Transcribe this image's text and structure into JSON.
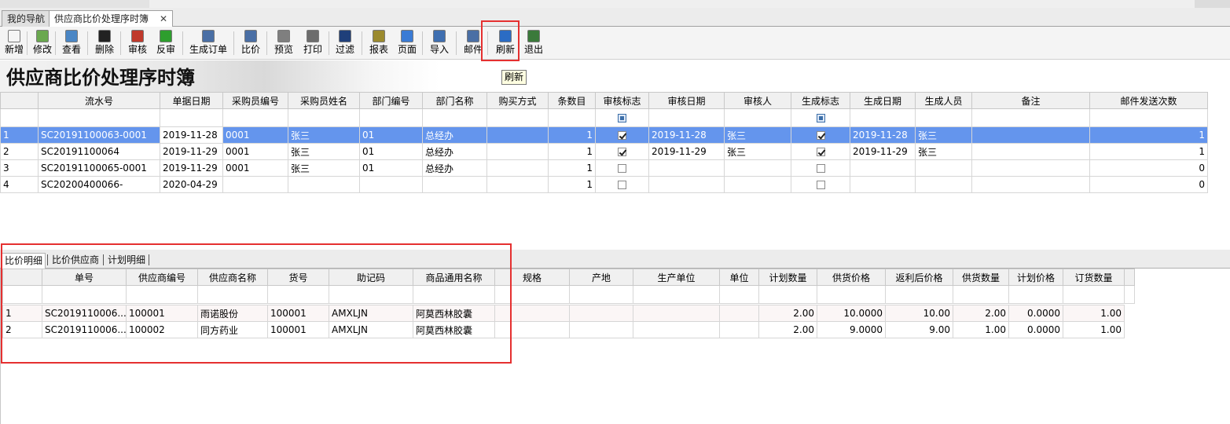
{
  "tabs": [
    {
      "label": "我的导航"
    },
    {
      "label": "供应商比价处理序时簿"
    }
  ],
  "toolbar": [
    {
      "label": "新增",
      "icon": "new-doc-icon",
      "color": "#f5f5f5"
    },
    {
      "label": "修改",
      "icon": "edit-icon",
      "color": "#6aa84f"
    },
    {
      "label": "查看",
      "icon": "view-icon",
      "color": "#4a86c5"
    },
    {
      "label": "删除",
      "icon": "delete-icon",
      "color": "#222222"
    },
    {
      "label": "审核",
      "icon": "audit-icon",
      "color": "#c0392b"
    },
    {
      "label": "反审",
      "icon": "unaudit-icon",
      "color": "#2e9e2e"
    },
    {
      "label": "生成订单",
      "icon": "order-icon",
      "color": "#4a6fa5"
    },
    {
      "label": "比价",
      "icon": "compare-icon",
      "color": "#4a6fa5"
    },
    {
      "label": "预览",
      "icon": "preview-icon",
      "color": "#7f7f7f"
    },
    {
      "label": "打印",
      "icon": "print-icon",
      "color": "#6d6d6d"
    },
    {
      "label": "过滤",
      "icon": "filter-icon",
      "color": "#1f3f7a"
    },
    {
      "label": "报表",
      "icon": "report-icon",
      "color": "#9b8a2e"
    },
    {
      "label": "页面",
      "icon": "page-icon",
      "color": "#3a7bd5"
    },
    {
      "label": "导入",
      "icon": "import-icon",
      "color": "#3f6fb0"
    },
    {
      "label": "邮件",
      "icon": "mail-icon",
      "color": "#4a6fa5"
    },
    {
      "label": "刷新",
      "icon": "refresh-icon",
      "color": "#2b6cc4"
    },
    {
      "label": "退出",
      "icon": "exit-icon",
      "color": "#3b7a3b"
    }
  ],
  "page_title": "供应商比价处理序时簿",
  "tooltip": "刷新",
  "main_grid": {
    "columns": [
      "流水号",
      "单据日期",
      "采购员编号",
      "采购员姓名",
      "部门编号",
      "部门名称",
      "购买方式",
      "条数目",
      "审核标志",
      "审核日期",
      "审核人",
      "生成标志",
      "生成日期",
      "生成人员",
      "备注",
      "邮件发送次数"
    ],
    "rows": [
      {
        "idx": "1",
        "serial": "SC20191100063-0001",
        "date": "2019-11-28",
        "buyer_no": "0001",
        "buyer": "张三",
        "dept_no": "01",
        "dept": "总经办",
        "method": "",
        "count": "1",
        "audited": true,
        "audit_date": "2019-11-28",
        "auditor": "张三",
        "generated": true,
        "gen_date": "2019-11-28",
        "gen_by": "张三",
        "remark": "",
        "mails": "1"
      },
      {
        "idx": "2",
        "serial": "SC20191100064",
        "date": "2019-11-29",
        "buyer_no": "0001",
        "buyer": "张三",
        "dept_no": "01",
        "dept": "总经办",
        "method": "",
        "count": "1",
        "audited": true,
        "audit_date": "2019-11-29",
        "auditor": "张三",
        "generated": true,
        "gen_date": "2019-11-29",
        "gen_by": "张三",
        "remark": "",
        "mails": "1"
      },
      {
        "idx": "3",
        "serial": "SC20191100065-0001",
        "date": "2019-11-29",
        "buyer_no": "0001",
        "buyer": "张三",
        "dept_no": "01",
        "dept": "总经办",
        "method": "",
        "count": "1",
        "audited": false,
        "audit_date": "",
        "auditor": "",
        "generated": false,
        "gen_date": "",
        "gen_by": "",
        "remark": "",
        "mails": "0"
      },
      {
        "idx": "4",
        "serial": "SC20200400066-",
        "date": "2020-04-29",
        "buyer_no": "",
        "buyer": "",
        "dept_no": "",
        "dept": "",
        "method": "",
        "count": "1",
        "audited": false,
        "audit_date": "",
        "auditor": "",
        "generated": false,
        "gen_date": "",
        "gen_by": "",
        "remark": "",
        "mails": "0"
      }
    ]
  },
  "detail_tabs": [
    {
      "label": "比价明细"
    },
    {
      "label": "比价供应商"
    },
    {
      "label": "计划明细"
    }
  ],
  "detail_grid": {
    "columns": [
      "单号",
      "供应商编号",
      "供应商名称",
      "货号",
      "助记码",
      "商品通用名称",
      "规格",
      "产地",
      "生产单位",
      "单位",
      "计划数量",
      "供货价格",
      "返利后价格",
      "供货数量",
      "计划价格",
      "订货数量"
    ],
    "rows": [
      {
        "idx": "1",
        "order": "SC2019110006...",
        "sup_no": "100001",
        "sup_name": "雨诺股份",
        "sku": "100001",
        "code": "AMXLJN",
        "name": "阿莫西林胶囊",
        "spec": "",
        "origin": "",
        "maker": "",
        "unit": "",
        "plan_qty": "2.00",
        "price": "10.0000",
        "rebate": "10.00",
        "supply_qty": "2.00",
        "plan_price": "0.0000",
        "order_qty": "1.00"
      },
      {
        "idx": "2",
        "order": "SC2019110006...",
        "sup_no": "100002",
        "sup_name": "同方药业",
        "sku": "100001",
        "code": "AMXLJN",
        "name": "阿莫西林胶囊",
        "spec": "",
        "origin": "",
        "maker": "",
        "unit": "",
        "plan_qty": "2.00",
        "price": "9.0000",
        "rebate": "9.00",
        "supply_qty": "1.00",
        "plan_price": "0.0000",
        "order_qty": "1.00"
      }
    ]
  },
  "colors": {
    "selection": "#6495ed",
    "highlight": "#e53030"
  }
}
